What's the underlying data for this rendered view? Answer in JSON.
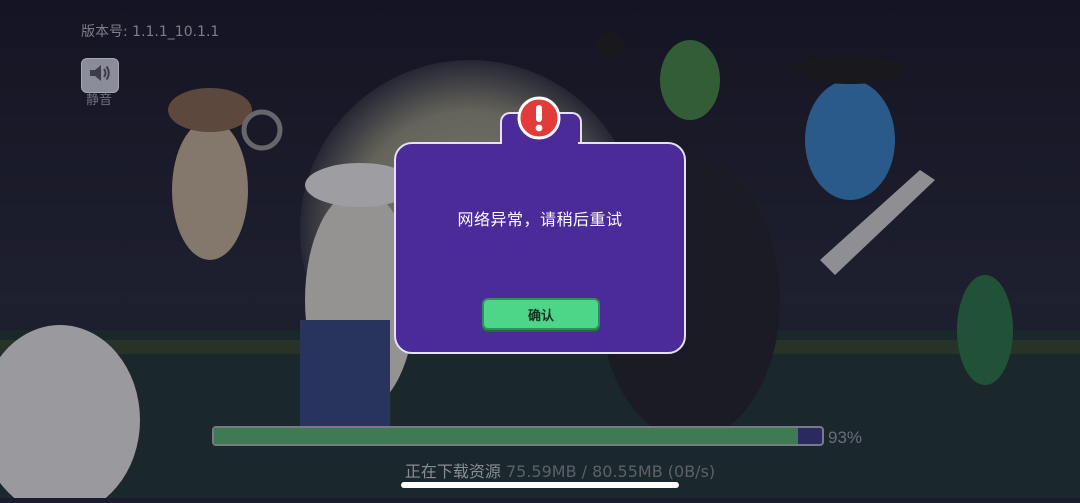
{
  "top_left": {
    "version_text": "版本号: 1.1.1_10.1.1",
    "mute_icon": "speaker-icon",
    "mute_label": "静音"
  },
  "dialog": {
    "icon": "exclamation-icon",
    "message": "网络异常，请稍后重试",
    "confirm_label": "确认",
    "colors": {
      "panel": "#4b2a9a",
      "button": "#4dd68a",
      "alert": "#e23b3b"
    }
  },
  "download": {
    "progress_fraction": 0.96,
    "percent_text": "93%",
    "status_label": "正在下载资源",
    "status_value": "75.59MB / 80.55MB (0B/s)"
  }
}
